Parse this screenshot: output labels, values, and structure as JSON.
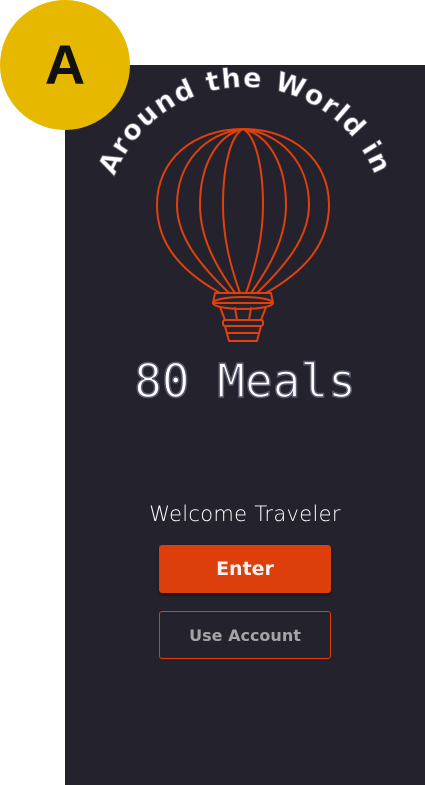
{
  "badge": {
    "letter": "A"
  },
  "logo": {
    "arc_text": "Around the World in",
    "title": "80 Meals"
  },
  "welcome": {
    "text": "Welcome Traveler"
  },
  "buttons": {
    "enter_label": "Enter",
    "account_label": "Use Account"
  },
  "colors": {
    "background": "#24232d",
    "accent": "#dc3f0b",
    "badge": "#e6b800"
  }
}
